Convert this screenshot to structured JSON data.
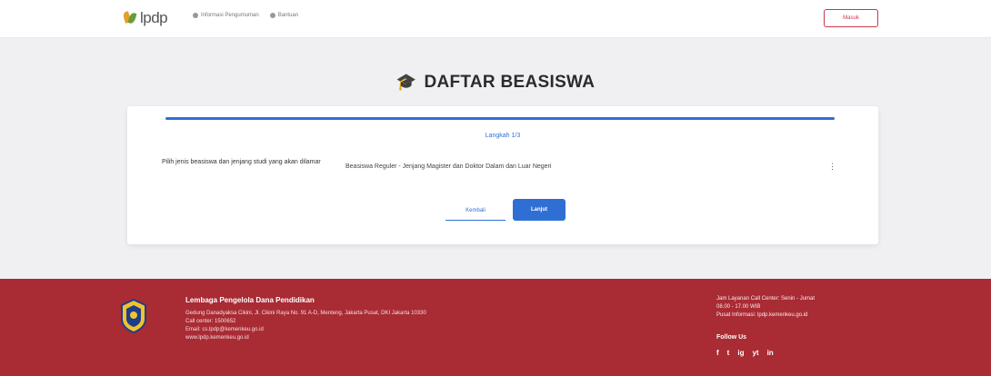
{
  "header": {
    "logo_text": "lpdp",
    "nav": [
      {
        "label": "Informasi Pengumuman",
        "icon": "info-icon"
      },
      {
        "label": "Bantuan",
        "icon": "help-icon"
      }
    ],
    "login_label": "Masuk"
  },
  "page": {
    "title": "DAFTAR BEASISWA",
    "title_icon": "graduation-cap-icon"
  },
  "form": {
    "progress_fraction": 1.0,
    "step_label": "Langkah 1/3",
    "question_label": "Pilih jenis beasiswa dan jenjang studi yang akan dilamar",
    "selected_value": "Beasiswa Reguler - Jenjang Magister dan Doktor Dalam dan Luar Negeri",
    "back_label": "Kembali",
    "next_label": "Lanjut"
  },
  "footer": {
    "org_name": "Lembaga Pengelola Dana Pendidikan",
    "address_lines": [
      "Gedung Danadyaksa Cikini, Jl. Cikini Raya No. 91 A-D, Menteng, Jakarta Pusat, DKI Jakarta 10330",
      "Call center: 1500652",
      "Email: cs.lpdp@kemenkeu.go.id",
      "www.lpdp.kemenkeu.go.id"
    ],
    "contact_lines": [
      "Jam Layanan Call Center: Senin - Jumat",
      "08.00 - 17.00 WIB",
      "Pusat Informasi: lpdp.kemenkeu.go.id"
    ],
    "follow_label": "Follow Us",
    "socials": [
      {
        "label": "f",
        "icon": "facebook-icon"
      },
      {
        "label": "t",
        "icon": "twitter-icon"
      },
      {
        "label": "ig",
        "icon": "instagram-icon"
      },
      {
        "label": "yt",
        "icon": "youtube-icon"
      },
      {
        "label": "in",
        "icon": "linkedin-icon"
      }
    ]
  },
  "colors": {
    "accent": "#2f6fd4",
    "footer_bg": "#a92b34",
    "login_border": "#c8374a"
  }
}
